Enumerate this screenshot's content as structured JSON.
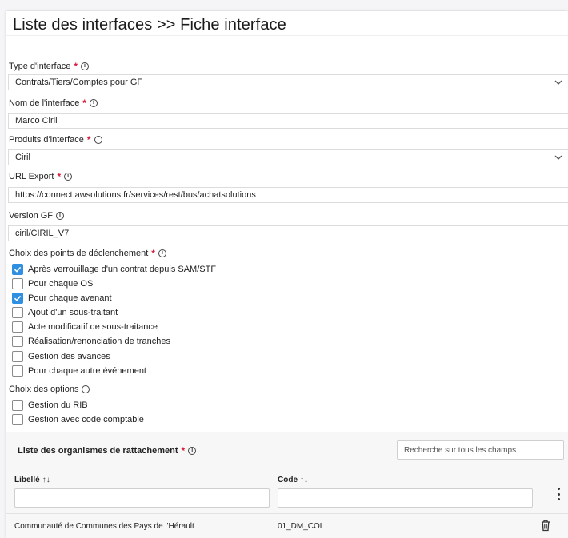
{
  "page": {
    "title": "Liste des interfaces >> Fiche interface"
  },
  "form": {
    "interface_type": {
      "label": "Type d'interface",
      "value": "Contrats/Tiers/Comptes pour GF"
    },
    "interface_name": {
      "label": "Nom de l'interface",
      "value": "Marco Ciril"
    },
    "interface_products": {
      "label": "Produits d'interface",
      "value": "Ciril"
    },
    "url_export": {
      "label": "URL Export",
      "value": "https://connect.awsolutions.fr/services/rest/bus/achatsolutions"
    },
    "gf_version": {
      "label": "Version GF",
      "value": "ciril/CIRIL_V7"
    },
    "triggers": {
      "label": "Choix des points de déclenchement",
      "items": [
        {
          "label": "Après verrouillage d'un contrat depuis SAM/STF",
          "checked": true
        },
        {
          "label": "Pour chaque OS",
          "checked": false
        },
        {
          "label": "Pour chaque avenant",
          "checked": true
        },
        {
          "label": "Ajout d'un sous-traitant",
          "checked": false
        },
        {
          "label": "Acte modificatif de sous-traitance",
          "checked": false
        },
        {
          "label": "Réalisation/renonciation de tranches",
          "checked": false
        },
        {
          "label": "Gestion des avances",
          "checked": false
        },
        {
          "label": "Pour chaque autre événement",
          "checked": false
        }
      ]
    },
    "options": {
      "label": "Choix des options",
      "items": [
        {
          "label": "Gestion du RIB",
          "checked": false
        },
        {
          "label": "Gestion avec code comptable",
          "checked": false
        }
      ]
    }
  },
  "organisms_table": {
    "title": "Liste des organismes de rattachement",
    "search_placeholder": "Recherche sur tous les champs",
    "columns": [
      {
        "label": "Libellé",
        "sort_icon": "↑↓"
      },
      {
        "label": "Code",
        "sort_icon": "↑↓"
      }
    ],
    "rows": [
      {
        "libelle": "Communauté de Communes des Pays de l'Hérault",
        "code": "01_DM_COL"
      }
    ]
  },
  "colors": {
    "accent": "#2f8fe0",
    "required": "#d81b3c"
  },
  "icons": {
    "info": "info-icon",
    "dropdown": "chevron-down-icon",
    "menu": "kebab-menu-icon",
    "delete": "trash-icon"
  }
}
